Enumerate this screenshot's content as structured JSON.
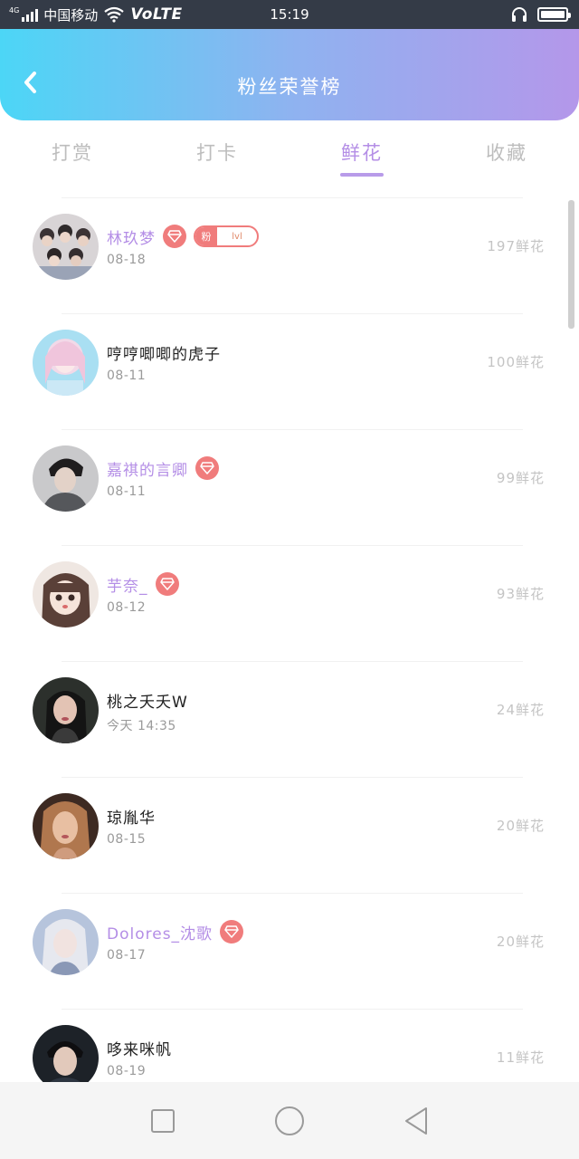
{
  "status_bar": {
    "network_type": "4G",
    "carrier": "中国移动",
    "volte": "VoLTE",
    "time": "15:19",
    "icons": [
      "signal-icon",
      "wifi-icon",
      "headphone-icon",
      "battery-icon"
    ]
  },
  "header": {
    "title": "粉丝荣誉榜",
    "back_icon": "chevron-left-icon",
    "gradient": [
      "#4cd6f6",
      "#b497ea"
    ]
  },
  "tabs": [
    {
      "label": "打赏",
      "active": false
    },
    {
      "label": "打卡",
      "active": false
    },
    {
      "label": "鲜花",
      "active": true
    },
    {
      "label": "收藏",
      "active": false
    }
  ],
  "fans": [
    {
      "name": "林玖梦",
      "date": "08-18",
      "count": "197鲜花",
      "vip": true,
      "diamond": true,
      "fan_badge": {
        "label": "粉",
        "level": "lvl"
      }
    },
    {
      "name": "哼哼唧唧的虎子",
      "date": "08-11",
      "count": "100鲜花",
      "vip": false,
      "diamond": false
    },
    {
      "name": "嘉祺的言卿",
      "date": "08-11",
      "count": "99鲜花",
      "vip": true,
      "diamond": true
    },
    {
      "name": "芋奈_",
      "date": "08-12",
      "count": "93鲜花",
      "vip": true,
      "diamond": true
    },
    {
      "name": "桃之夭夭W",
      "date": "今天 14:35",
      "count": "24鲜花",
      "vip": false,
      "diamond": false
    },
    {
      "name": "琼胤华",
      "date": "08-15",
      "count": "20鲜花",
      "vip": false,
      "diamond": false
    },
    {
      "name": "Dolores_沈歌",
      "date": "08-17",
      "count": "20鲜花",
      "vip": true,
      "diamond": true
    },
    {
      "name": "哆来咪帆",
      "date": "08-19",
      "count": "11鲜花",
      "vip": false,
      "diamond": false
    }
  ],
  "colors": {
    "accent": "#b48ee6",
    "badge": "#f07c7c",
    "status_bar": "#343b47"
  },
  "nav_bar": {
    "items": [
      "recent-apps-icon",
      "home-icon",
      "back-icon"
    ]
  }
}
